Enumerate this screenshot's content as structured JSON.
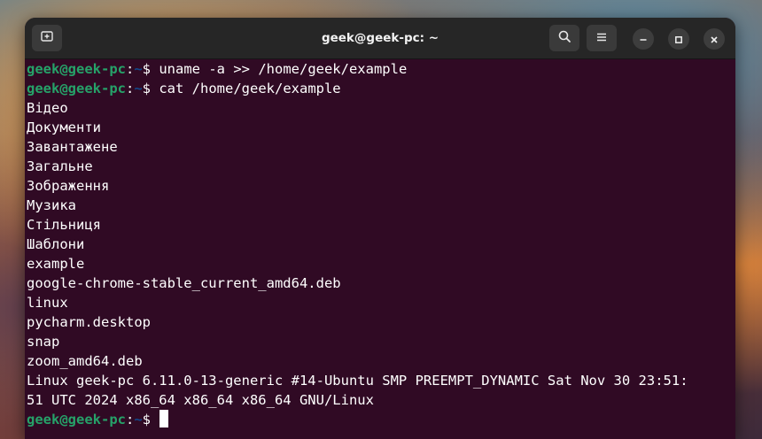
{
  "window": {
    "title": "geek@geek-pc: ~"
  },
  "terminal": {
    "prompt_user": "geek@geek-pc",
    "prompt_colon": ":",
    "prompt_path": "~",
    "prompt_symbol": "$ ",
    "commands": [
      "uname -a >> /home/geek/example",
      "cat /home/geek/example"
    ],
    "output": [
      "Відео",
      "Документи",
      "Завантажене",
      "Загальне",
      "Зображення",
      "Музика",
      "Стільниця",
      "Шаблони",
      "example",
      "google-chrome-stable_current_amd64.deb",
      "linux",
      "pycharm.desktop",
      "snap",
      "zoom_amd64.deb",
      "Linux geek-pc 6.11.0-13-generic #14-Ubuntu SMP PREEMPT_DYNAMIC Sat Nov 30 23:51:",
      "51 UTC 2024 x86_64 x86_64 x86_64 GNU/Linux"
    ]
  },
  "icons": {
    "new_tab": "new-tab-icon",
    "search": "search-icon",
    "menu": "hamburger-menu-icon",
    "minimize": "minimize-icon",
    "maximize": "maximize-icon",
    "close": "close-icon"
  },
  "colors": {
    "terminal_bg": "#300a24",
    "prompt_user": "#26a269",
    "prompt_path": "#12488b",
    "titlebar_bg": "#262626"
  }
}
